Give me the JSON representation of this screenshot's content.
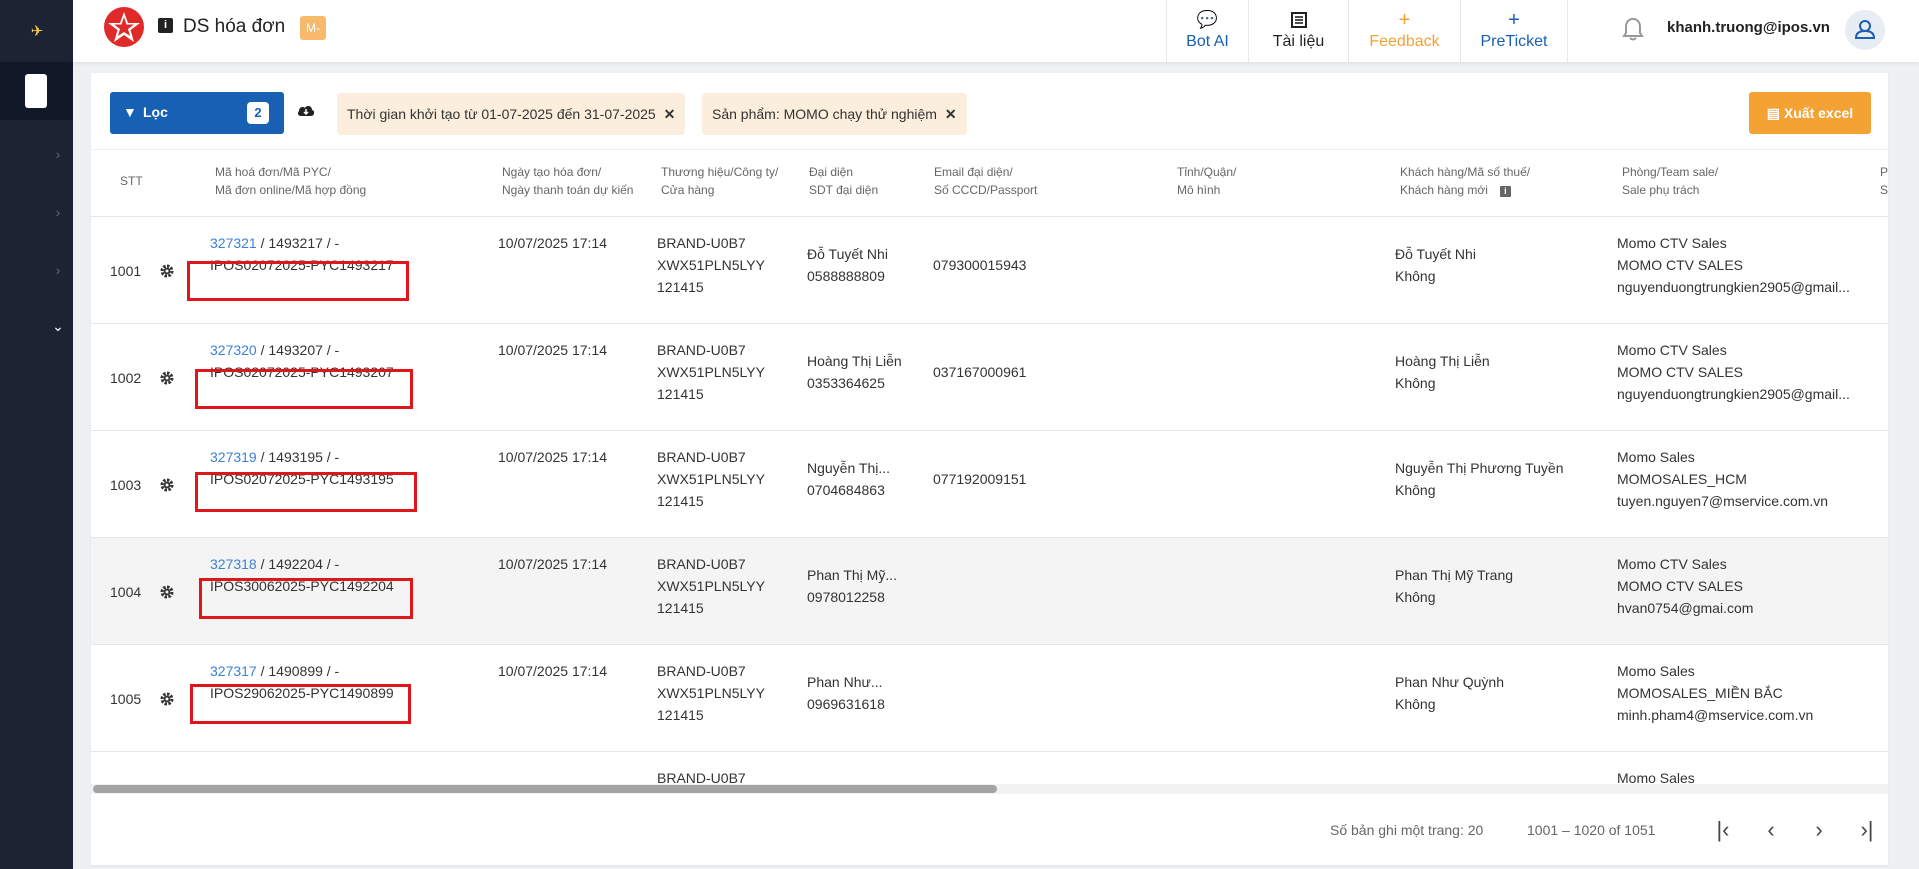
{
  "app": {
    "title": "DS hóa đơn",
    "badge": "M-"
  },
  "header_nav": [
    {
      "icon": "💬",
      "label": "Bot AI",
      "color": "#1760b4"
    },
    {
      "icon": "📖",
      "label": "Tài liệu",
      "color": "#222222"
    },
    {
      "icon": "+",
      "label": "Feedback",
      "color": "#f4a234"
    },
    {
      "icon": "+",
      "label": "PreTicket",
      "color": "#1760b4"
    }
  ],
  "user": {
    "email": "khanh.truong@ipos.vn"
  },
  "toolbar": {
    "filter_label": "Lọc",
    "filter_count": "2",
    "chips": [
      {
        "text": "Thời gian khởi tạo từ 01-07-2025 đến 31-07-2025",
        "close": "✕"
      },
      {
        "text": "Sản phẩm: MOMO chạy thử nghiệm",
        "close": "✕"
      }
    ],
    "export_label": "Xuất excel"
  },
  "table": {
    "headers": {
      "stt": "STT",
      "code1": "Mã hoá đơn/Mã PYC/",
      "code2": "Mã đơn online/Mã hợp đồng",
      "date1": "Ngày tạo hóa đơn/",
      "date2": "Ngày thanh toán dự kiến",
      "brand1": "Thương hiệu/Công ty/",
      "brand2": "Cửa hàng",
      "rep1": "Đại diện",
      "rep2": "SDT đại diện",
      "email1": "Email đại diện/",
      "email2": "Số CCCD/Passport",
      "prov1": "Tỉnh/Quận/",
      "prov2": "Mô hình",
      "cust1": "Khách hàng/Mã số thuế/",
      "cust2": "Khách hàng mới",
      "team1": "Phòng/Team sale/",
      "team2": "Sale phụ trách",
      "extra1": "P",
      "extra2": "S"
    },
    "rows": [
      {
        "stt": "1001",
        "link": "327321",
        "code_rest": " / 1493217 / -",
        "pyc": "IPOS02072025-PYC1493217",
        "date": "10/07/2025 17:14",
        "brand": [
          "BRAND-U0B7",
          "XWX51PLN5LYY",
          "121415"
        ],
        "rep": "Đỗ Tuyết Nhi",
        "phone": "0588888809",
        "email": "079300015943",
        "customer": "Đỗ Tuyết Nhi",
        "new_customer": "Không",
        "team": [
          "Momo CTV Sales",
          "MOMO CTV SALES",
          "nguyenduongtrungkien2905@gmail..."
        ]
      },
      {
        "stt": "1002",
        "link": "327320",
        "code_rest": " / 1493207 / -",
        "pyc": "IPOS02072025-PYC1493207",
        "date": "10/07/2025 17:14",
        "brand": [
          "BRAND-U0B7",
          "XWX51PLN5LYY",
          "121415"
        ],
        "rep": "Hoàng Thị Liễn",
        "phone": "0353364625",
        "email": "037167000961",
        "customer": "Hoàng Thị Liễn",
        "new_customer": "Không",
        "team": [
          "Momo CTV Sales",
          "MOMO CTV SALES",
          "nguyenduongtrungkien2905@gmail..."
        ]
      },
      {
        "stt": "1003",
        "link": "327319",
        "code_rest": " / 1493195 / -",
        "pyc": "IPOS02072025-PYC1493195",
        "date": "10/07/2025 17:14",
        "brand": [
          "BRAND-U0B7",
          "XWX51PLN5LYY",
          "121415"
        ],
        "rep": "Nguyễn Thị...",
        "phone": "0704684863",
        "email": "077192009151",
        "customer": "Nguyễn Thị Phương Tuyền",
        "new_customer": "Không",
        "team": [
          "Momo Sales",
          "MOMOSALES_HCM",
          "tuyen.nguyen7@mservice.com.vn"
        ]
      },
      {
        "stt": "1004",
        "link": "327318",
        "code_rest": " / 1492204 / -",
        "pyc": "IPOS30062025-PYC1492204",
        "date": "10/07/2025 17:14",
        "brand": [
          "BRAND-U0B7",
          "XWX51PLN5LYY",
          "121415"
        ],
        "rep": "Phan Thị Mỹ...",
        "phone": "0978012258",
        "email": "",
        "customer": "Phan Thị Mỹ Trang",
        "new_customer": "Không",
        "team": [
          "Momo CTV Sales",
          "MOMO CTV SALES",
          "hvan0754@gmai.com"
        ]
      },
      {
        "stt": "1005",
        "link": "327317",
        "code_rest": " / 1490899 / -",
        "pyc": "IPOS29062025-PYC1490899",
        "date": "10/07/2025 17:14",
        "brand": [
          "BRAND-U0B7",
          "XWX51PLN5LYY",
          "121415"
        ],
        "rep": "Phan Như...",
        "phone": "0969631618",
        "email": "",
        "customer": "Phan Như Quỳnh",
        "new_customer": "Không",
        "team": [
          "Momo Sales",
          "MOMOSALES_MIỀN BẮC",
          "minh.pham4@mservice.com.vn"
        ]
      }
    ],
    "partial_row": {
      "brand": "BRAND-U0B7",
      "team": "Momo Sales"
    }
  },
  "pagination": {
    "page_size_label": "Số bản ghi một trang: 20",
    "range_label": "1001 – 1020 of 1051",
    "first": "|‹",
    "prev": "‹",
    "next": "›",
    "last": "›|"
  }
}
